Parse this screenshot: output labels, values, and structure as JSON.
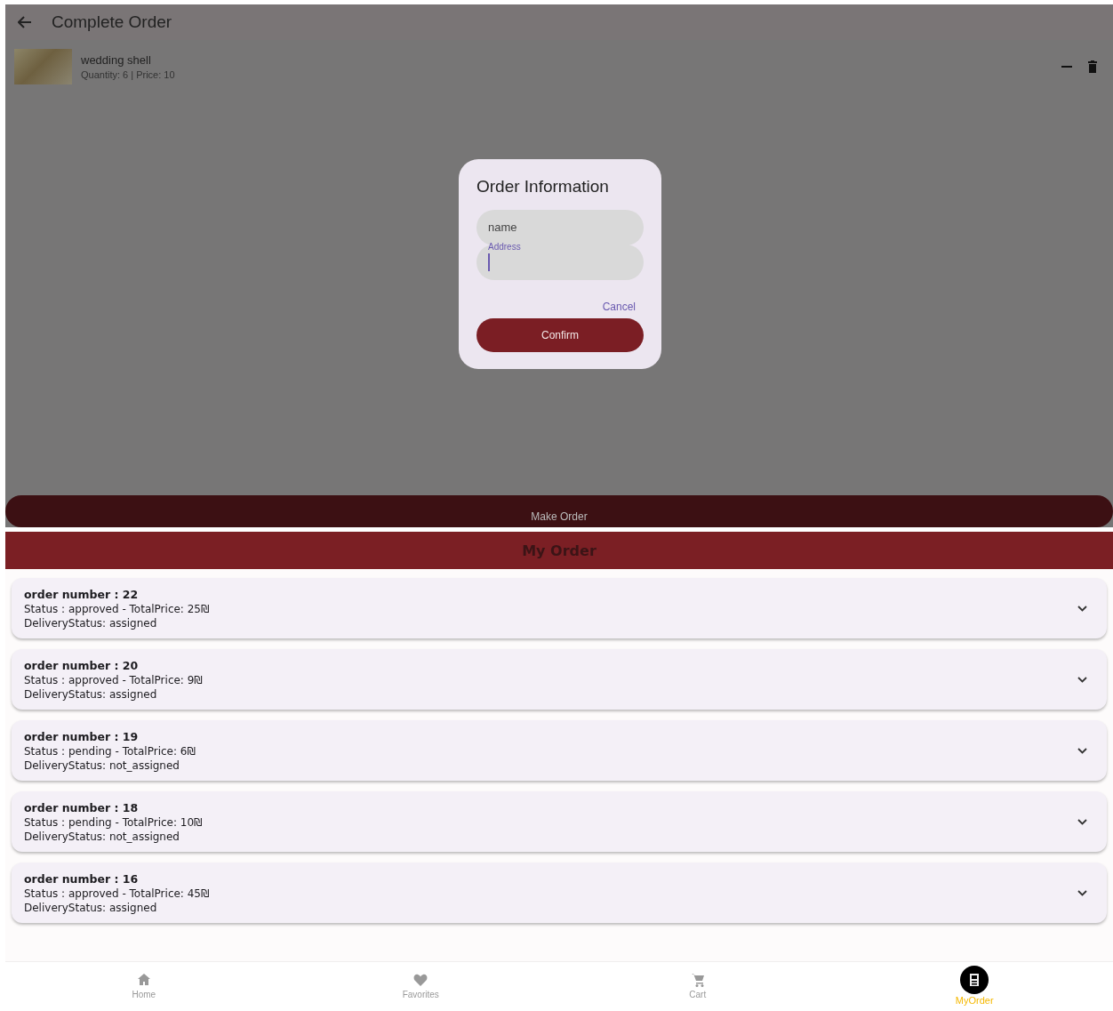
{
  "complete_order": {
    "title": "Complete Order",
    "cart_items": [
      {
        "name": "wedding shell",
        "details": "Quantity: 6 | Price: 10"
      }
    ],
    "make_order_button": "Make Order"
  },
  "dialog": {
    "title": "Order Information",
    "fields": [
      {
        "label": "name",
        "focused": false
      },
      {
        "label": "Address",
        "focused": true
      }
    ],
    "cancel": "Cancel",
    "confirm": "Confirm"
  },
  "my_order": {
    "title": "My Order",
    "orders": [
      {
        "title": "order number : 22",
        "status": "Status : approved - TotalPrice: 25₪",
        "delivery": "DeliveryStatus: assigned",
        "expanded": false
      },
      {
        "title": "order number : 20",
        "status": "Status : approved - TotalPrice: 9₪",
        "delivery": "DeliveryStatus: assigned",
        "expanded": false
      },
      {
        "title": "order number : 19",
        "status": "Status : pending - TotalPrice: 6₪",
        "delivery": "DeliveryStatus: not_assigned",
        "expanded": false
      },
      {
        "title": "order number : 18",
        "status": "Status : pending - TotalPrice: 10₪",
        "delivery": "DeliveryStatus: not_assigned",
        "expanded": false
      },
      {
        "title": "order number : 16",
        "status": "Status : approved - TotalPrice: 45₪",
        "delivery": "DeliveryStatus: assigned",
        "expanded": false
      }
    ]
  },
  "bottom_nav": [
    {
      "label": "Home",
      "kind": "home",
      "selected": false
    },
    {
      "label": "Favorites",
      "kind": "favorites",
      "selected": false
    },
    {
      "label": "Cart",
      "kind": "cart",
      "selected": false
    },
    {
      "label": "MyOrder",
      "kind": "orders",
      "selected": true
    }
  ]
}
